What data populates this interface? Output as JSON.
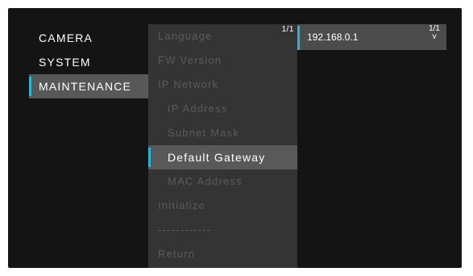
{
  "menu": {
    "col1": [
      {
        "label": "CAMERA",
        "active": false
      },
      {
        "label": "SYSTEM",
        "active": false
      },
      {
        "label": "MAINTENANCE",
        "active": true
      }
    ],
    "col2": {
      "page_indicator": "1/1",
      "items": [
        {
          "label": "Language",
          "sub": false,
          "active": false
        },
        {
          "label": "FW Version",
          "sub": false,
          "active": false
        },
        {
          "label": "IP Network",
          "sub": false,
          "active": false
        },
        {
          "label": "IP Address",
          "sub": true,
          "active": false
        },
        {
          "label": "Subnet Mask",
          "sub": true,
          "active": false
        },
        {
          "label": "Default Gateway",
          "sub": true,
          "active": true
        },
        {
          "label": "MAC Address",
          "sub": true,
          "active": false
        },
        {
          "label": "Initialize",
          "sub": false,
          "active": false
        },
        {
          "label": "------------",
          "sub": false,
          "active": false
        },
        {
          "label": "Return",
          "sub": false,
          "active": false
        }
      ]
    },
    "col3": {
      "value": "192.168.0.1",
      "page_indicator": "1/1",
      "scroll_glyph": "v"
    }
  },
  "colors": {
    "accent": "#2ab4d8",
    "background": "#141414",
    "panel": "#343434",
    "active_bg": "#595959",
    "dim_text": "#5b5b5b"
  }
}
